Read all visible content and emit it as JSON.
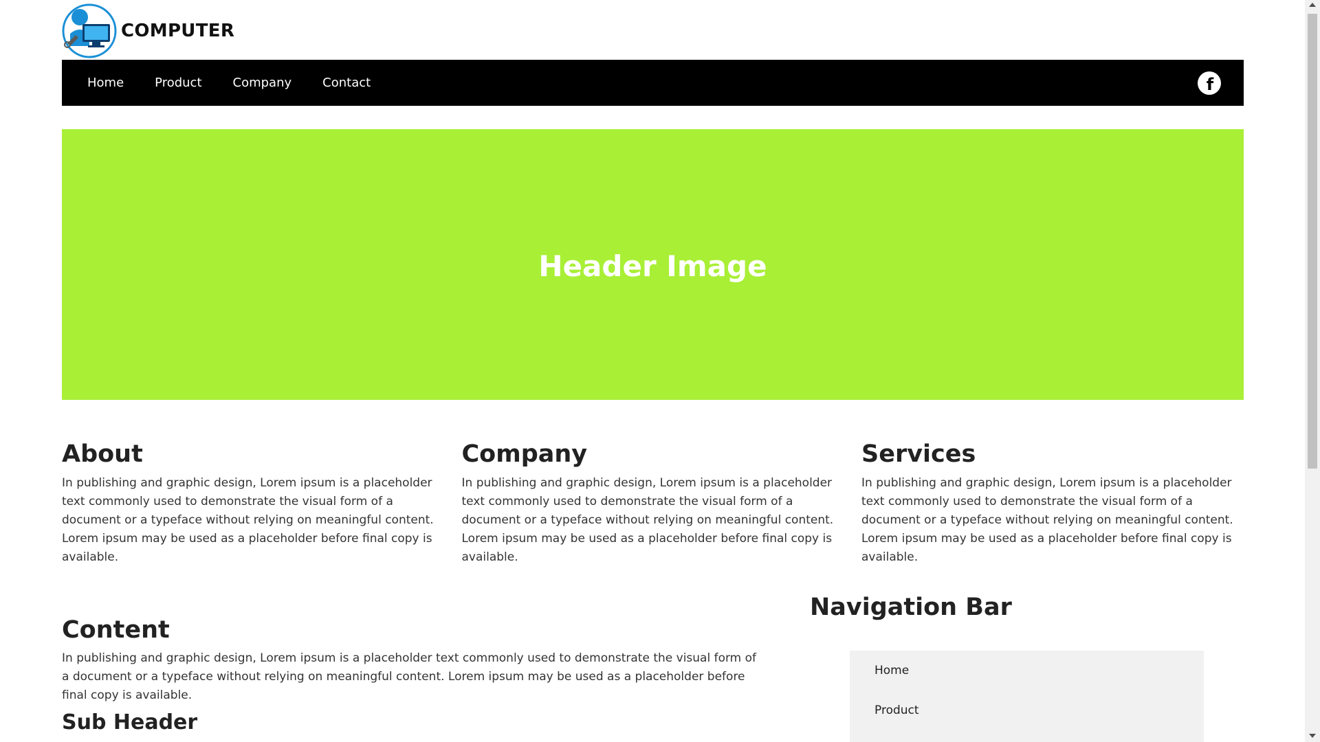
{
  "brand": {
    "name": "COMPUTER"
  },
  "topnav": {
    "items": [
      {
        "label": "Home"
      },
      {
        "label": "Product"
      },
      {
        "label": "Company"
      },
      {
        "label": "Contact"
      }
    ],
    "social_icon": "facebook-icon",
    "social_glyph": "f"
  },
  "hero": {
    "title": "Header Image",
    "background": "#a9ef36"
  },
  "columns": [
    {
      "title": "About",
      "text": "In publishing and graphic design, Lorem ipsum is a placeholder text commonly used to demonstrate the visual form of a document or a typeface without relying on meaningful content. Lorem ipsum may be used as a placeholder before final copy is available."
    },
    {
      "title": "Company",
      "text": "In publishing and graphic design, Lorem ipsum is a placeholder text commonly used to demonstrate the visual form of a document or a typeface without relying on meaningful content. Lorem ipsum may be used as a placeholder before final copy is available."
    },
    {
      "title": "Services",
      "text": "In publishing and graphic design, Lorem ipsum is a placeholder text commonly used to demonstrate the visual form of a document or a typeface without relying on meaningful content. Lorem ipsum may be used as a placeholder before final copy is available."
    }
  ],
  "content": {
    "title": "Content",
    "text": "In publishing and graphic design, Lorem ipsum is a placeholder text commonly used to demonstrate the visual form of a document or a typeface without relying on meaningful content. Lorem ipsum may be used as a placeholder before final copy is available.",
    "subheader": "Sub Header"
  },
  "sidebar": {
    "title": "Navigation Bar",
    "items": [
      {
        "label": "Home"
      },
      {
        "label": "Product"
      }
    ]
  },
  "colors": {
    "nav_bg": "#000000",
    "hero_bg": "#a9ef36",
    "sidenav_bg": "#f1f1f1",
    "logo_blue": "#1a8fd6"
  }
}
